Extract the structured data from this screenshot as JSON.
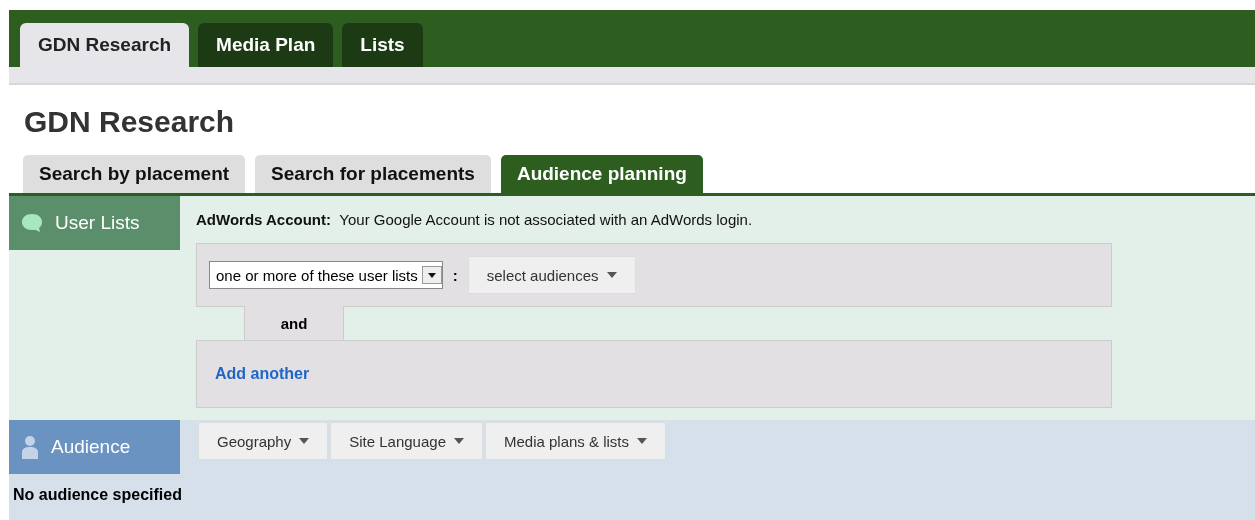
{
  "top_tabs": [
    {
      "label": "GDN Research",
      "selected": true
    },
    {
      "label": "Media Plan",
      "selected": false
    },
    {
      "label": "Lists",
      "selected": false
    }
  ],
  "page_title": "GDN Research",
  "sub_tabs": [
    {
      "label": "Search by placement",
      "selected": false
    },
    {
      "label": "Search for placements",
      "selected": false
    },
    {
      "label": "Audience planning",
      "selected": true
    }
  ],
  "user_lists": {
    "label": "User Lists",
    "account_label": "AdWords Account:",
    "account_message": "Your Google Account is not associated with an AdWords login.",
    "match_select": "one or more of these user lists",
    "separator": ":",
    "audiences_button": "select audiences",
    "connector": "and",
    "add_link": "Add another"
  },
  "audience": {
    "label": "Audience",
    "filters": [
      "Geography",
      "Site Language",
      "Media plans & lists"
    ],
    "status": "No audience specified"
  }
}
